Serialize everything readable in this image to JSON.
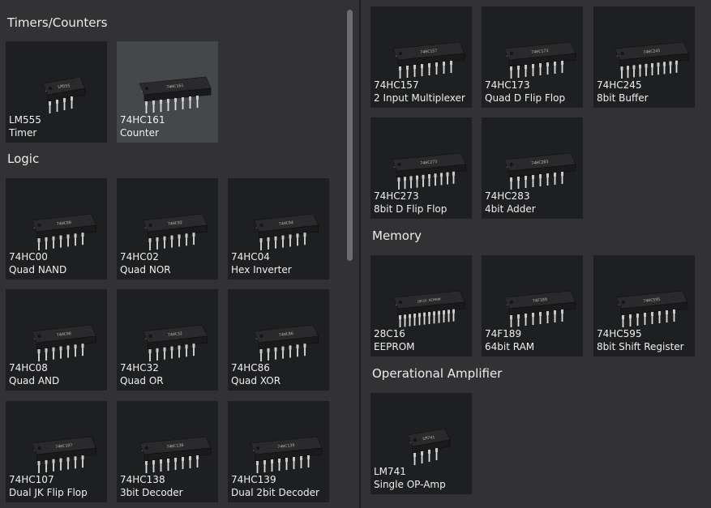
{
  "left": {
    "sections": [
      {
        "title": "Timers/Counters",
        "items": [
          {
            "name": "LM555",
            "desc": "Timer",
            "marking": "LM555",
            "pins": 4,
            "selected": false
          },
          {
            "name": "74HC161",
            "desc": "Counter",
            "marking": "74HC161",
            "pins": 8,
            "selected": true
          }
        ]
      },
      {
        "title": "Logic",
        "items": [
          {
            "name": "74HC00",
            "desc": "Quad NAND",
            "marking": "74HC00",
            "pins": 7
          },
          {
            "name": "74HC02",
            "desc": "Quad NOR",
            "marking": "74HC02",
            "pins": 7
          },
          {
            "name": "74HC04",
            "desc": "Hex Inverter",
            "marking": "74HC04",
            "pins": 7
          },
          {
            "name": "74HC08",
            "desc": "Quad AND",
            "marking": "74HC08",
            "pins": 7
          },
          {
            "name": "74HC32",
            "desc": "Quad OR",
            "marking": "74HC32",
            "pins": 7
          },
          {
            "name": "74HC86",
            "desc": "Quad XOR",
            "marking": "74HC86",
            "pins": 7
          },
          {
            "name": "74HC107",
            "desc": "Dual JK Flip Flop",
            "marking": "74HC107",
            "pins": 7
          },
          {
            "name": "74HC138",
            "desc": "3bit Decoder",
            "marking": "74HC138",
            "pins": 8
          },
          {
            "name": "74HC139",
            "desc": "Dual 2bit Decoder",
            "marking": "74HC139",
            "pins": 8
          }
        ]
      }
    ]
  },
  "right": {
    "top_items": [
      {
        "name": "74HC157",
        "desc": "2 Input Multiplexer",
        "marking": "74HC157",
        "pins": 8
      },
      {
        "name": "74HC173",
        "desc": "Quad D Flip Flop",
        "marking": "74HC173",
        "pins": 8
      },
      {
        "name": "74HC245",
        "desc": "8bit Buffer",
        "marking": "74HC245",
        "pins": 10
      },
      {
        "name": "74HC273",
        "desc": "8bit D Flip Flop",
        "marking": "74HC273",
        "pins": 10
      },
      {
        "name": "74HC283",
        "desc": "4bit Adder",
        "marking": "74HC283",
        "pins": 8
      }
    ],
    "sections": [
      {
        "title": "Memory",
        "items": [
          {
            "name": "28C16",
            "desc": "EEPROM",
            "marking": "28C16 EEPROM",
            "pins": 12
          },
          {
            "name": "74F189",
            "desc": "64bit RAM",
            "marking": "74F189",
            "pins": 8
          },
          {
            "name": "74HC595",
            "desc": "8bit Shift Register",
            "marking": "74HC595",
            "pins": 8
          }
        ]
      },
      {
        "title": "Operational Amplifier",
        "items": [
          {
            "name": "LM741",
            "desc": "Single OP-Amp",
            "marking": "LM741",
            "pins": 4
          }
        ]
      }
    ]
  },
  "colors": {
    "background": "#323234",
    "tile": "#1e1f21",
    "tile_selected": "#45484a",
    "chip_body": "#1a1a1c",
    "chip_top": "#2a2a2d",
    "pin": "#c8c8c8",
    "text": "#f0f0f0"
  }
}
